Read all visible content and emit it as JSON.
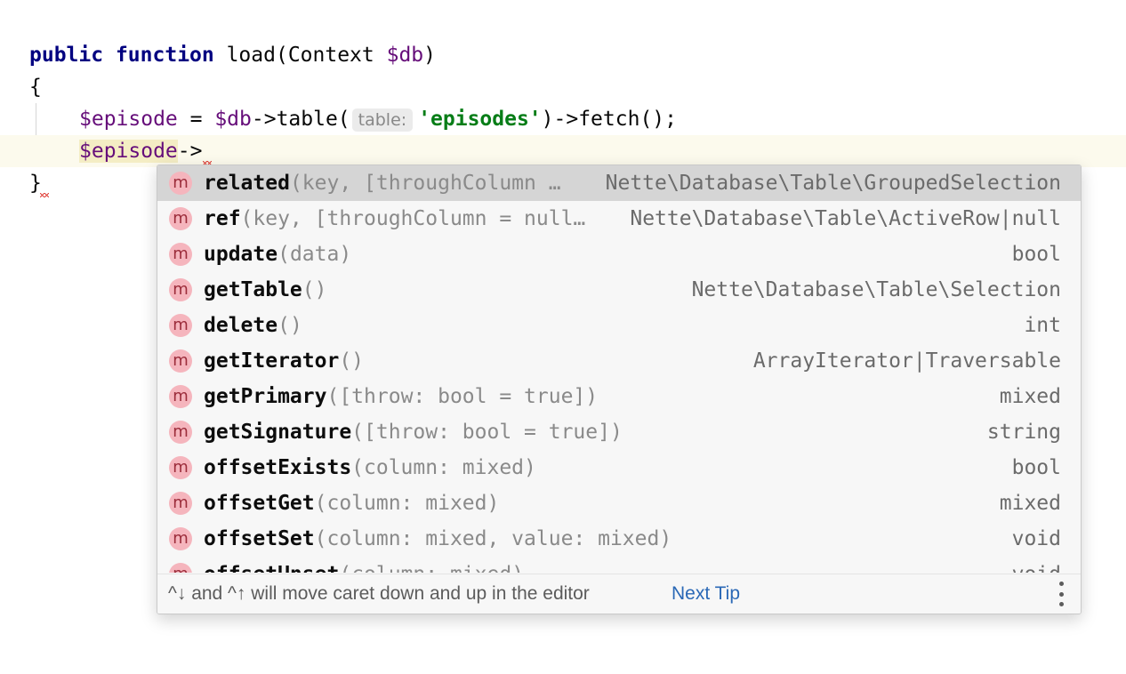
{
  "code": {
    "line1": {
      "kw1": "public",
      "kw2": "function",
      "name": " load(Context ",
      "param": "$db",
      "close": ")"
    },
    "line2": {
      "text": "{"
    },
    "line3": {
      "var1": "$episode",
      "eq": " = ",
      "var2": "$db",
      "call1": "->table(",
      "hint": "table:",
      "str": "'episodes'",
      "call2": ")->fetch();"
    },
    "line4": {
      "var": "$episode",
      "arrow": "->"
    },
    "line5": {
      "text": "}"
    }
  },
  "completion": {
    "badge": "m",
    "items": [
      {
        "name": "related",
        "sig": "(key, [throughColumn …",
        "type": "Nette\\Database\\Table\\GroupedSelection",
        "selected": true
      },
      {
        "name": "ref",
        "sig": "(key, [throughColumn = null…",
        "type": "Nette\\Database\\Table\\ActiveRow|null"
      },
      {
        "name": "update",
        "sig": "(data)",
        "type": "bool"
      },
      {
        "name": "getTable",
        "sig": "()",
        "type": "Nette\\Database\\Table\\Selection"
      },
      {
        "name": "delete",
        "sig": "()",
        "type": "int"
      },
      {
        "name": "getIterator",
        "sig": "()",
        "type": "ArrayIterator|Traversable"
      },
      {
        "name": "getPrimary",
        "sig": "([throw: bool = true])",
        "type": "mixed"
      },
      {
        "name": "getSignature",
        "sig": "([throw: bool = true])",
        "type": "string"
      },
      {
        "name": "offsetExists",
        "sig": "(column: mixed)",
        "type": "bool"
      },
      {
        "name": "offsetGet",
        "sig": "(column: mixed)",
        "type": "mixed"
      },
      {
        "name": "offsetSet",
        "sig": "(column: mixed, value: mixed)",
        "type": "void"
      },
      {
        "name": "offsetUnset",
        "sig": "(column: mixed)",
        "type": "void"
      }
    ],
    "footer": {
      "tip": "^↓ and ^↑ will move caret down and up in the editor",
      "next_tip": "Next Tip",
      "menu_icon": "more-vertical-icon"
    }
  },
  "colors": {
    "keyword": "#000080",
    "variable": "#660e7a",
    "string": "#067d17",
    "link": "#2a68b6",
    "badge_bg": "#f5b5bd",
    "error": "#e0443e"
  }
}
